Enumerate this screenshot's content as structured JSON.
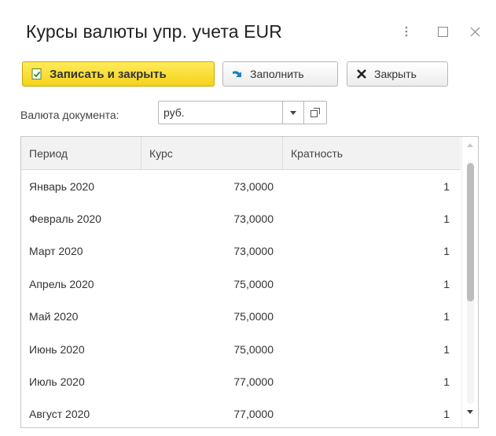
{
  "window": {
    "title": "Курсы валюты упр. учета EUR"
  },
  "toolbar": {
    "save_label": "Записать и закрыть",
    "fill_label": "Заполнить",
    "close_label": "Закрыть"
  },
  "currency_field": {
    "label": "Валюта документа:",
    "value": "руб."
  },
  "table": {
    "columns": [
      "Период",
      "Курс",
      "Кратность"
    ],
    "rows": [
      {
        "period": "Январь 2020",
        "rate": "73,0000",
        "multiplicity": "1"
      },
      {
        "period": "Февраль 2020",
        "rate": "73,0000",
        "multiplicity": "1"
      },
      {
        "period": "Март 2020",
        "rate": "73,0000",
        "multiplicity": "1"
      },
      {
        "period": "Апрель 2020",
        "rate": "75,0000",
        "multiplicity": "1"
      },
      {
        "period": "Май 2020",
        "rate": "75,0000",
        "multiplicity": "1"
      },
      {
        "period": "Июнь 2020",
        "rate": "75,0000",
        "multiplicity": "1"
      },
      {
        "period": "Июль 2020",
        "rate": "77,0000",
        "multiplicity": "1"
      },
      {
        "period": "Август 2020",
        "rate": "77,0000",
        "multiplicity": "1"
      }
    ]
  },
  "icons": {
    "more": "more-vertical-icon",
    "maximize": "maximize-icon",
    "close": "close-icon",
    "save": "save-document-icon",
    "fill": "fill-arrow-icon",
    "close_button": "x-icon",
    "dropdown": "chevron-down-icon",
    "open": "open-window-icon"
  },
  "colors": {
    "primary_button": "#f5d21a",
    "fill_arrow": "#1f7fc4"
  }
}
